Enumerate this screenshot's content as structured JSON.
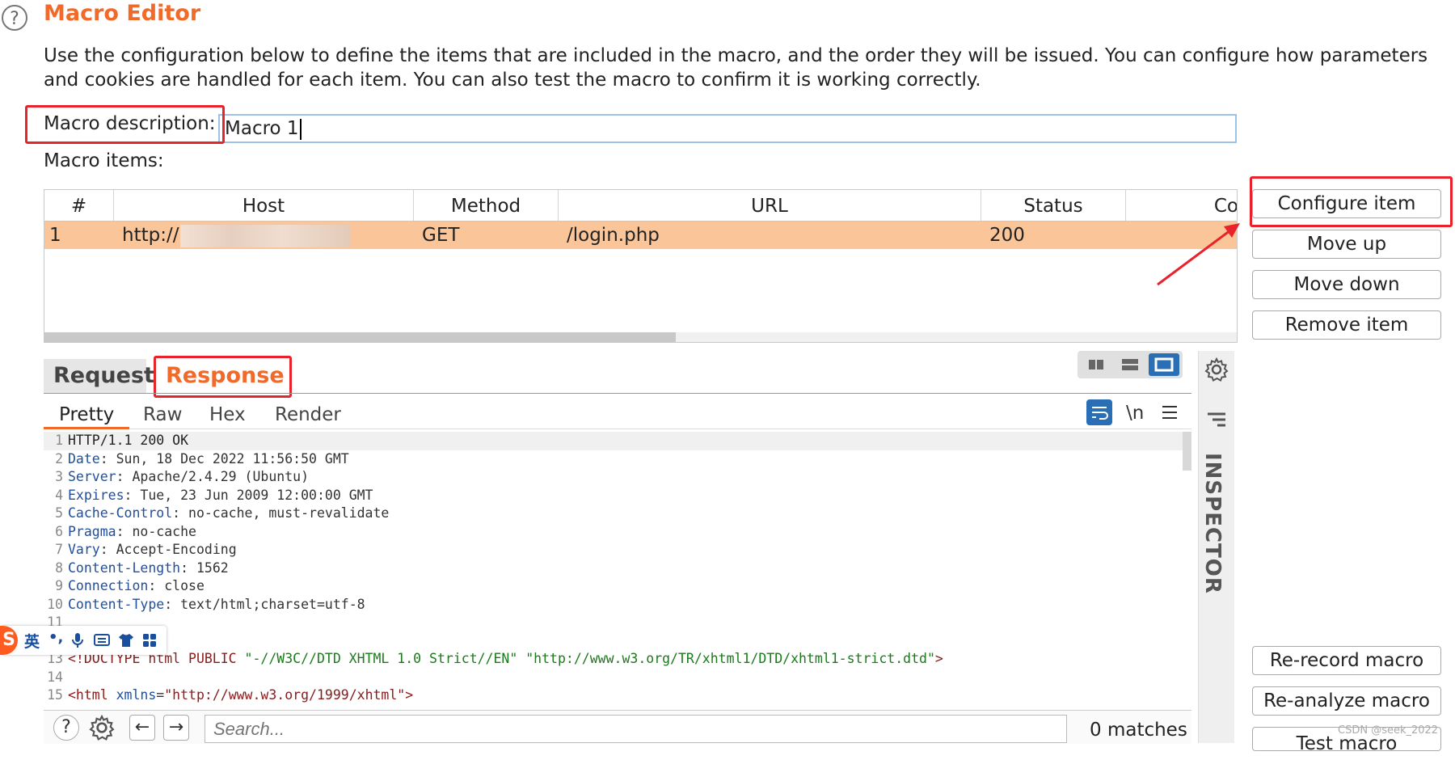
{
  "header": {
    "title": "Macro Editor",
    "description": "Use the configuration below to define the items that are included in the macro, and the order they will be issued. You can configure how parameters and cookies are handled for each item. You can also test the macro to confirm it is working correctly."
  },
  "macro_description": {
    "label": "Macro description:",
    "value": "Macro 1"
  },
  "macro_items": {
    "label": "Macro items:",
    "columns": [
      "#",
      "Host",
      "Method",
      "URL",
      "Status",
      "Co"
    ],
    "rows": [
      {
        "num": "1",
        "host": "http://",
        "method": "GET",
        "url": "/login.php",
        "status": "200"
      }
    ]
  },
  "side_buttons": {
    "configure": "Configure item",
    "move_up": "Move up",
    "move_down": "Move down",
    "remove": "Remove item",
    "rerecord": "Re-record macro",
    "reanalyze": "Re-analyze macro",
    "test": "Test macro"
  },
  "tabs": {
    "request": "Request",
    "response": "Response"
  },
  "subtabs": {
    "pretty": "Pretty",
    "raw": "Raw",
    "hex": "Hex",
    "render": "Render",
    "newline_toggle": "\\n"
  },
  "response_lines": {
    "l1": {
      "num": "1",
      "text": "HTTP/1.1 200 OK"
    },
    "l2": {
      "num": "2",
      "key": "Date",
      "value": ": Sun, 18 Dec 2022 11:56:50 GMT"
    },
    "l3": {
      "num": "3",
      "key": "Server",
      "value": ": Apache/2.4.29 (Ubuntu)"
    },
    "l4": {
      "num": "4",
      "key": "Expires",
      "value": ": Tue, 23 Jun 2009 12:00:00 GMT"
    },
    "l5": {
      "num": "5",
      "key": "Cache-Control",
      "value": ": no-cache, must-revalidate"
    },
    "l6": {
      "num": "6",
      "key": "Pragma",
      "value": ": no-cache"
    },
    "l7": {
      "num": "7",
      "key": "Vary",
      "value": ": Accept-Encoding"
    },
    "l8": {
      "num": "8",
      "key": "Content-Length",
      "value": ": 1562"
    },
    "l9": {
      "num": "9",
      "key": "Connection",
      "value": ": close"
    },
    "l10": {
      "num": "10",
      "key": "Content-Type",
      "value": ": text/html;charset=utf-8"
    },
    "l11": {
      "num": "11"
    },
    "l13": {
      "num": "13",
      "tag_open": "<!DOCTYPE html PUBLIC ",
      "str1": "\"-//W3C//DTD XHTML 1.0 Strict//EN\"",
      "str2": " \"http://www.w3.org/TR/xhtml1/DTD/xhtml1-strict.dtd\"",
      "tag_close": ">"
    },
    "l14": {
      "num": "14"
    },
    "l15": {
      "num": "15",
      "tag_open": "<html ",
      "attr": "xmlns",
      "eq": "=",
      "str": "\"http://www.w3.org/1999/xhtml\"",
      "tag_close": ">"
    }
  },
  "inspector": {
    "label": "INSPECTOR"
  },
  "search": {
    "placeholder": "Search...",
    "matches": "0 matches"
  },
  "ime_toolbar": {
    "lang": "英",
    "punct": "•,"
  },
  "watermark": "CSDN @seek_2022",
  "colors": {
    "accent": "#f16a2a",
    "selected_row": "#fbc59a",
    "annotation_red": "#e8232b"
  }
}
